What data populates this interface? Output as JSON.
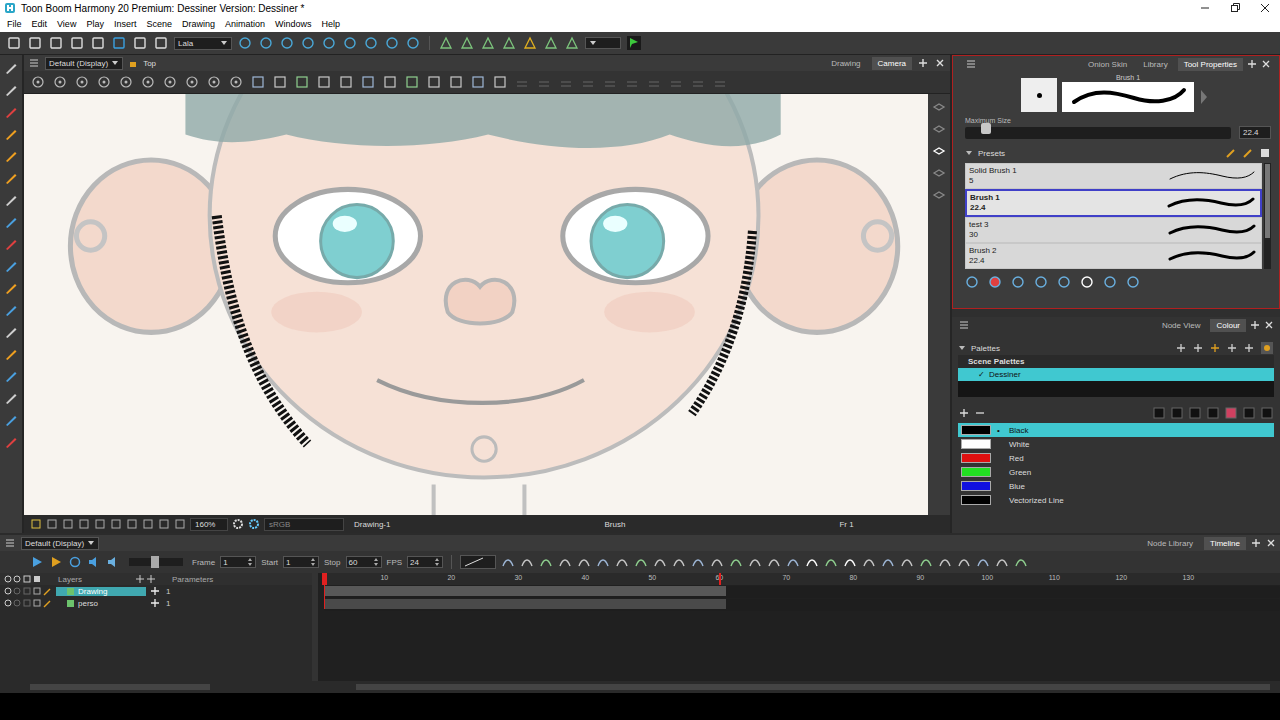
{
  "window": {
    "title": "Toon Boom Harmony 20 Premium: Dessiner Version: Dessiner *"
  },
  "menu": [
    "File",
    "Edit",
    "View",
    "Play",
    "Insert",
    "Scene",
    "Drawing",
    "Animation",
    "Windows",
    "Help"
  ],
  "toolbar": {
    "dropdown": "Lala"
  },
  "camera": {
    "view_preset": "Default (Display)",
    "view_name": "Top",
    "tabs": [
      {
        "label": "Drawing",
        "selected": false
      },
      {
        "label": "Camera",
        "selected": true
      }
    ],
    "status": {
      "zoom": "160%",
      "color_space": "sRGB",
      "drawing": "Drawing-1",
      "tool": "Brush",
      "frame": "Fr 1"
    }
  },
  "tool_properties": {
    "tabs": [
      {
        "label": "Onion Skin",
        "selected": false
      },
      {
        "label": "Library",
        "selected": false
      },
      {
        "label": "Tool Properties",
        "selected": true
      }
    ],
    "brush_name": "Brush 1",
    "max_size": {
      "label": "Maximum Size",
      "level": 0.08,
      "reading": "22.4"
    },
    "presets_label": "Presets",
    "presets": [
      {
        "name": "Solid Brush 1",
        "size": "5",
        "selected": false
      },
      {
        "name": "Brush 1",
        "size": "22.4",
        "selected": true
      },
      {
        "name": "test 3",
        "size": "30",
        "selected": false
      },
      {
        "name": "Brush 2",
        "size": "22.4",
        "selected": false
      }
    ]
  },
  "colour": {
    "tabs": [
      {
        "label": "Node View",
        "selected": false
      },
      {
        "label": "Colour",
        "selected": true
      }
    ],
    "palettes_label": "Palettes",
    "palette_group": "Scene Palettes",
    "check_mark": "✓",
    "palettes": [
      {
        "name": "Dessiner",
        "checked": true,
        "selected": true
      }
    ],
    "default_mark": "•",
    "colours": [
      {
        "name": "Black",
        "color": "#000000",
        "selected": true,
        "default": true
      },
      {
        "name": "White",
        "color": "#ffffff",
        "selected": false,
        "default": false
      },
      {
        "name": "Red",
        "color": "#e01010",
        "selected": false,
        "default": false
      },
      {
        "name": "Green",
        "color": "#22e022",
        "selected": false,
        "default": false
      },
      {
        "name": "Blue",
        "color": "#1010e0",
        "selected": false,
        "default": false
      },
      {
        "name": "Vectorized Line",
        "color": "#000000",
        "selected": false,
        "default": false
      }
    ]
  },
  "timeline": {
    "view_preset": "Default (Display)",
    "tabs": [
      {
        "label": "Node Library",
        "selected": false
      },
      {
        "label": "Timeline",
        "selected": true
      }
    ],
    "fields": [
      {
        "label": "Frame",
        "value": "1"
      },
      {
        "label": "Start",
        "value": "1"
      },
      {
        "label": "Stop",
        "value": "60"
      },
      {
        "label": "FPS",
        "value": "24"
      }
    ],
    "columns": [
      "Layers",
      "Parameters"
    ],
    "layers": [
      {
        "name": "Drawing",
        "value": "1",
        "selected": true
      },
      {
        "name": "perso",
        "value": "1",
        "selected": false
      }
    ],
    "ruler": [
      "10",
      "20",
      "30",
      "40",
      "50",
      "60",
      "70",
      "80",
      "90",
      "100",
      "110",
      "120",
      "130"
    ]
  }
}
